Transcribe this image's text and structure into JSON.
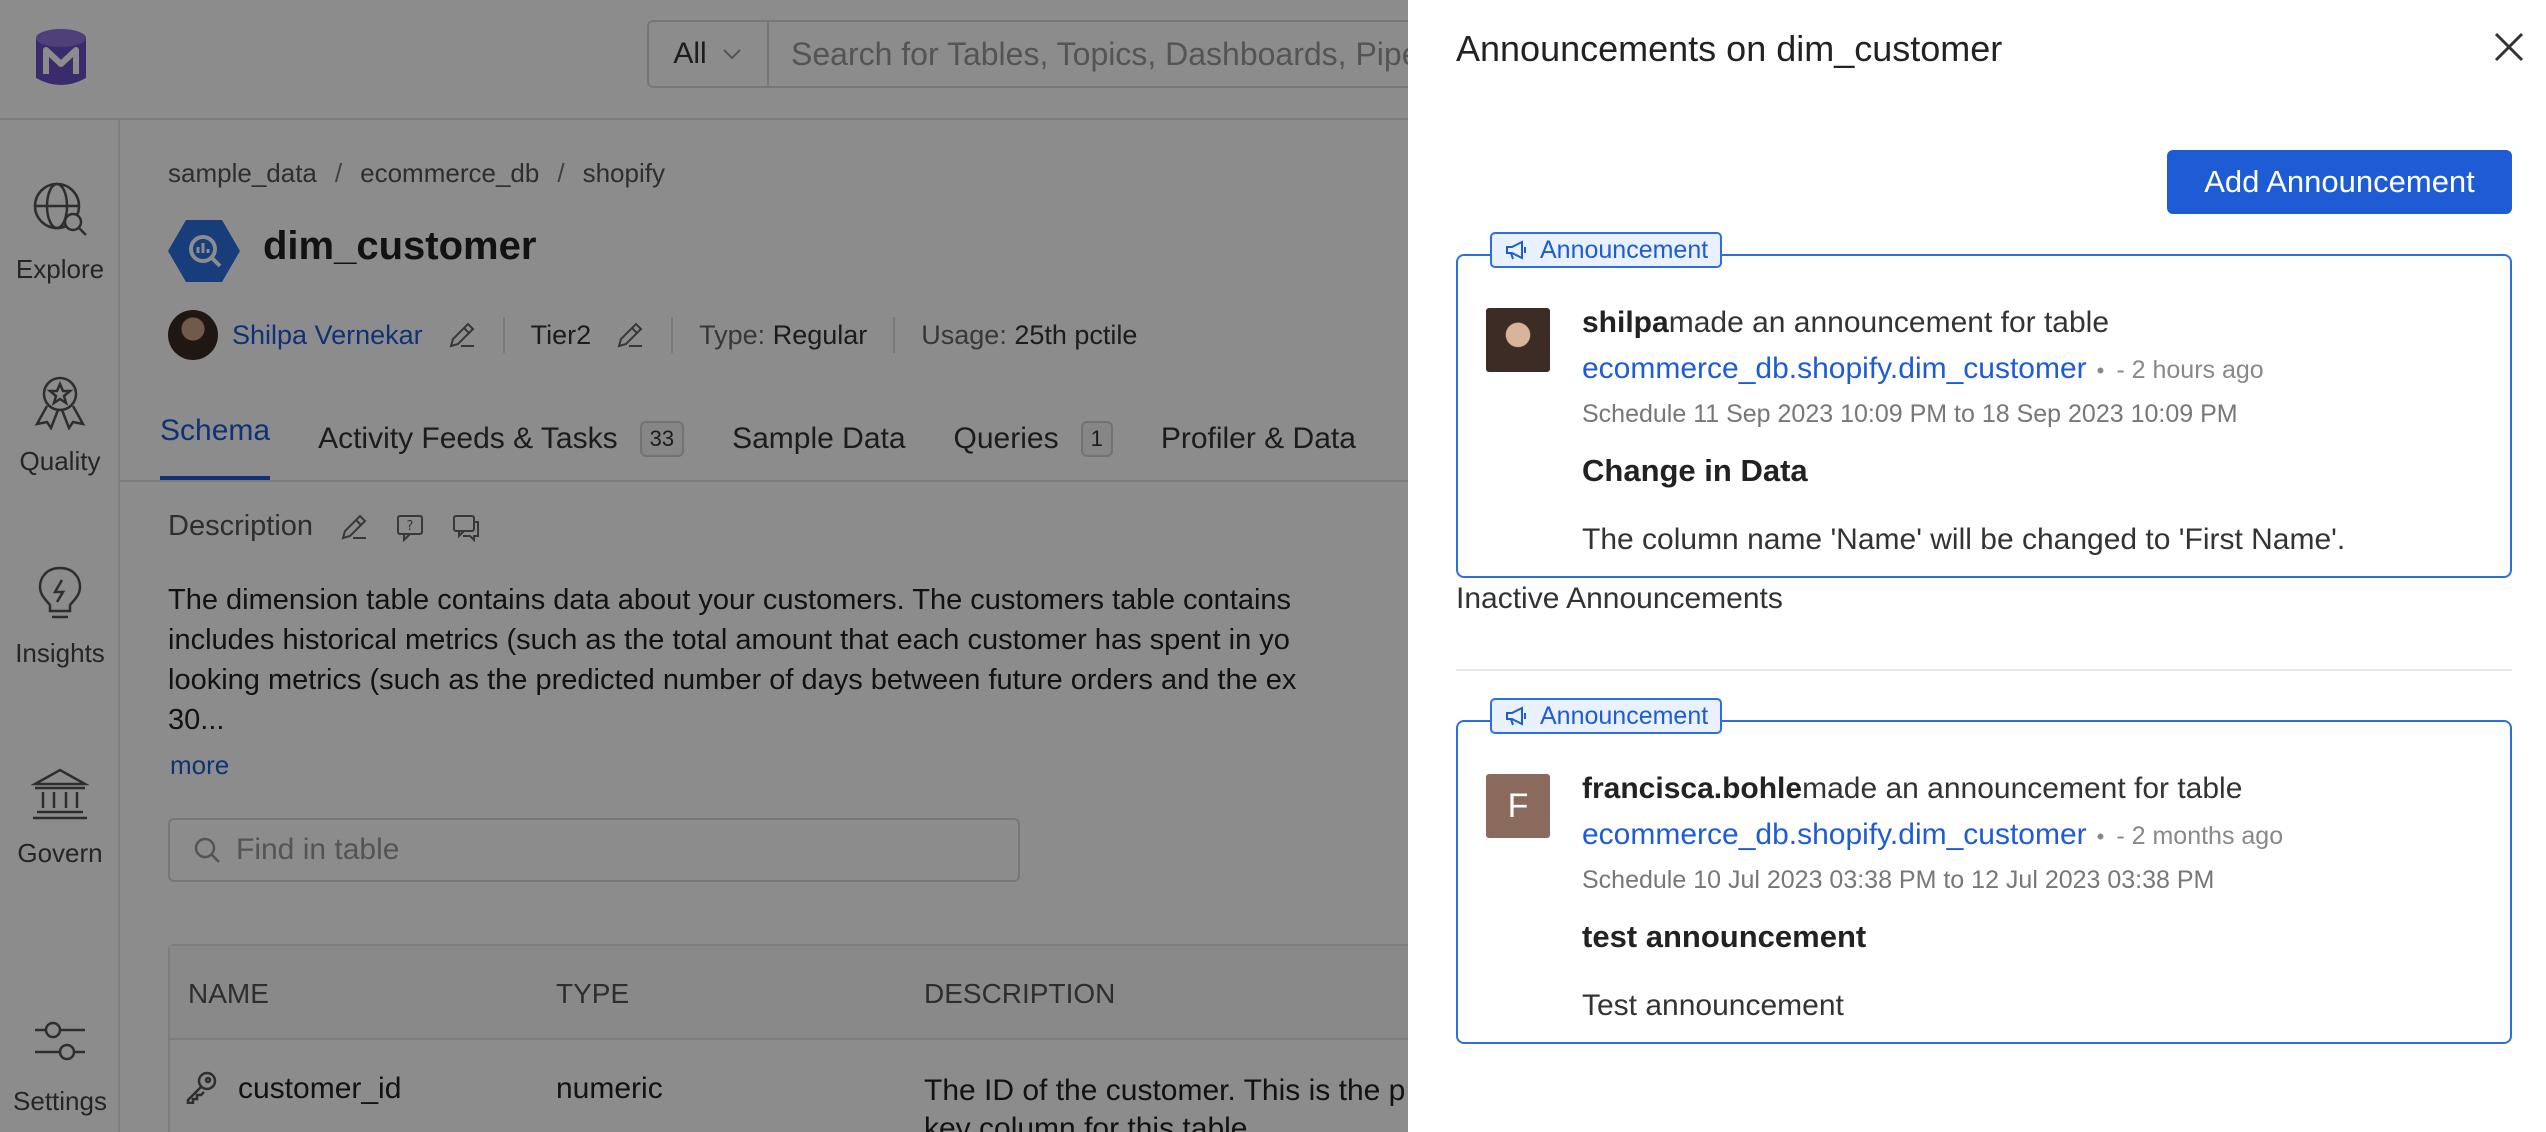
{
  "header": {
    "search_scope": "All",
    "search_placeholder": "Search for Tables, Topics, Dashboards, Pipelines"
  },
  "sidebar": {
    "items": [
      {
        "label": "Explore",
        "icon": "globe-search-icon"
      },
      {
        "label": "Quality",
        "icon": "quality-badge-icon"
      },
      {
        "label": "Insights",
        "icon": "lightbulb-icon"
      },
      {
        "label": "Govern",
        "icon": "bank-icon"
      },
      {
        "label": "Settings",
        "icon": "sliders-icon"
      }
    ]
  },
  "entity": {
    "breadcrumbs": [
      "sample_data",
      "ecommerce_db",
      "shopify"
    ],
    "breadcrumb_sep": "/",
    "name": "dim_customer",
    "owner": "Shilpa Vernekar",
    "tier": "Tier2",
    "type_label": "Type:",
    "type_value": "Regular",
    "usage_label": "Usage:",
    "usage_value": "25th pctile"
  },
  "tabs": [
    {
      "label": "Schema",
      "active": true
    },
    {
      "label": "Activity Feeds & Tasks",
      "count": "33"
    },
    {
      "label": "Sample Data"
    },
    {
      "label": "Queries",
      "count": "1"
    },
    {
      "label": "Profiler & Data"
    }
  ],
  "description": {
    "label": "Description",
    "lines": [
      "The dimension table contains data about your customers. The customers table contains",
      "includes historical metrics (such as the total amount that each customer has spent in yo",
      "looking metrics (such as the predicted number of days between future orders and the ex",
      "30..."
    ],
    "more": "more"
  },
  "find_placeholder": "Find in table",
  "table": {
    "headers": [
      "NAME",
      "TYPE",
      "DESCRIPTION"
    ],
    "rows": [
      {
        "name": "customer_id",
        "type": "numeric",
        "description_l1": "The ID of the customer. This is the p",
        "description_l2": "key column for this table."
      }
    ]
  },
  "drawer": {
    "title": "Announcements on dim_customer",
    "add_button": "Add Announcement",
    "tag_label": "Announcement",
    "inactive_label": "Inactive Announcements",
    "announcements": [
      {
        "user": "shilpa",
        "action": "made an announcement for table",
        "entity_link": "ecommerce_db.shopify.dim_customer",
        "dot": "•",
        "time_ago": "- 2 hours ago",
        "schedule": "Schedule 11 Sep 2023 10:09 PM to 18 Sep 2023 10:09 PM",
        "title": "Change in Data",
        "description": "The column name 'Name' will be changed to 'First Name'."
      },
      {
        "user": "francisca.bohle",
        "avatar_letter": "F",
        "action": "made an announcement for table",
        "entity_link": "ecommerce_db.shopify.dim_customer",
        "dot": "•",
        "time_ago": "- 2 months ago",
        "schedule": "Schedule 10 Jul 2023 03:38 PM to 12 Jul 2023 03:38 PM",
        "title": "test announcement",
        "description": "Test announcement"
      }
    ]
  },
  "colors": {
    "accent": "#1e5cd6",
    "card_border": "#2d6fe0",
    "overlay": "rgba(0,0,0,0.45)",
    "logo": "#6a4fc7"
  }
}
